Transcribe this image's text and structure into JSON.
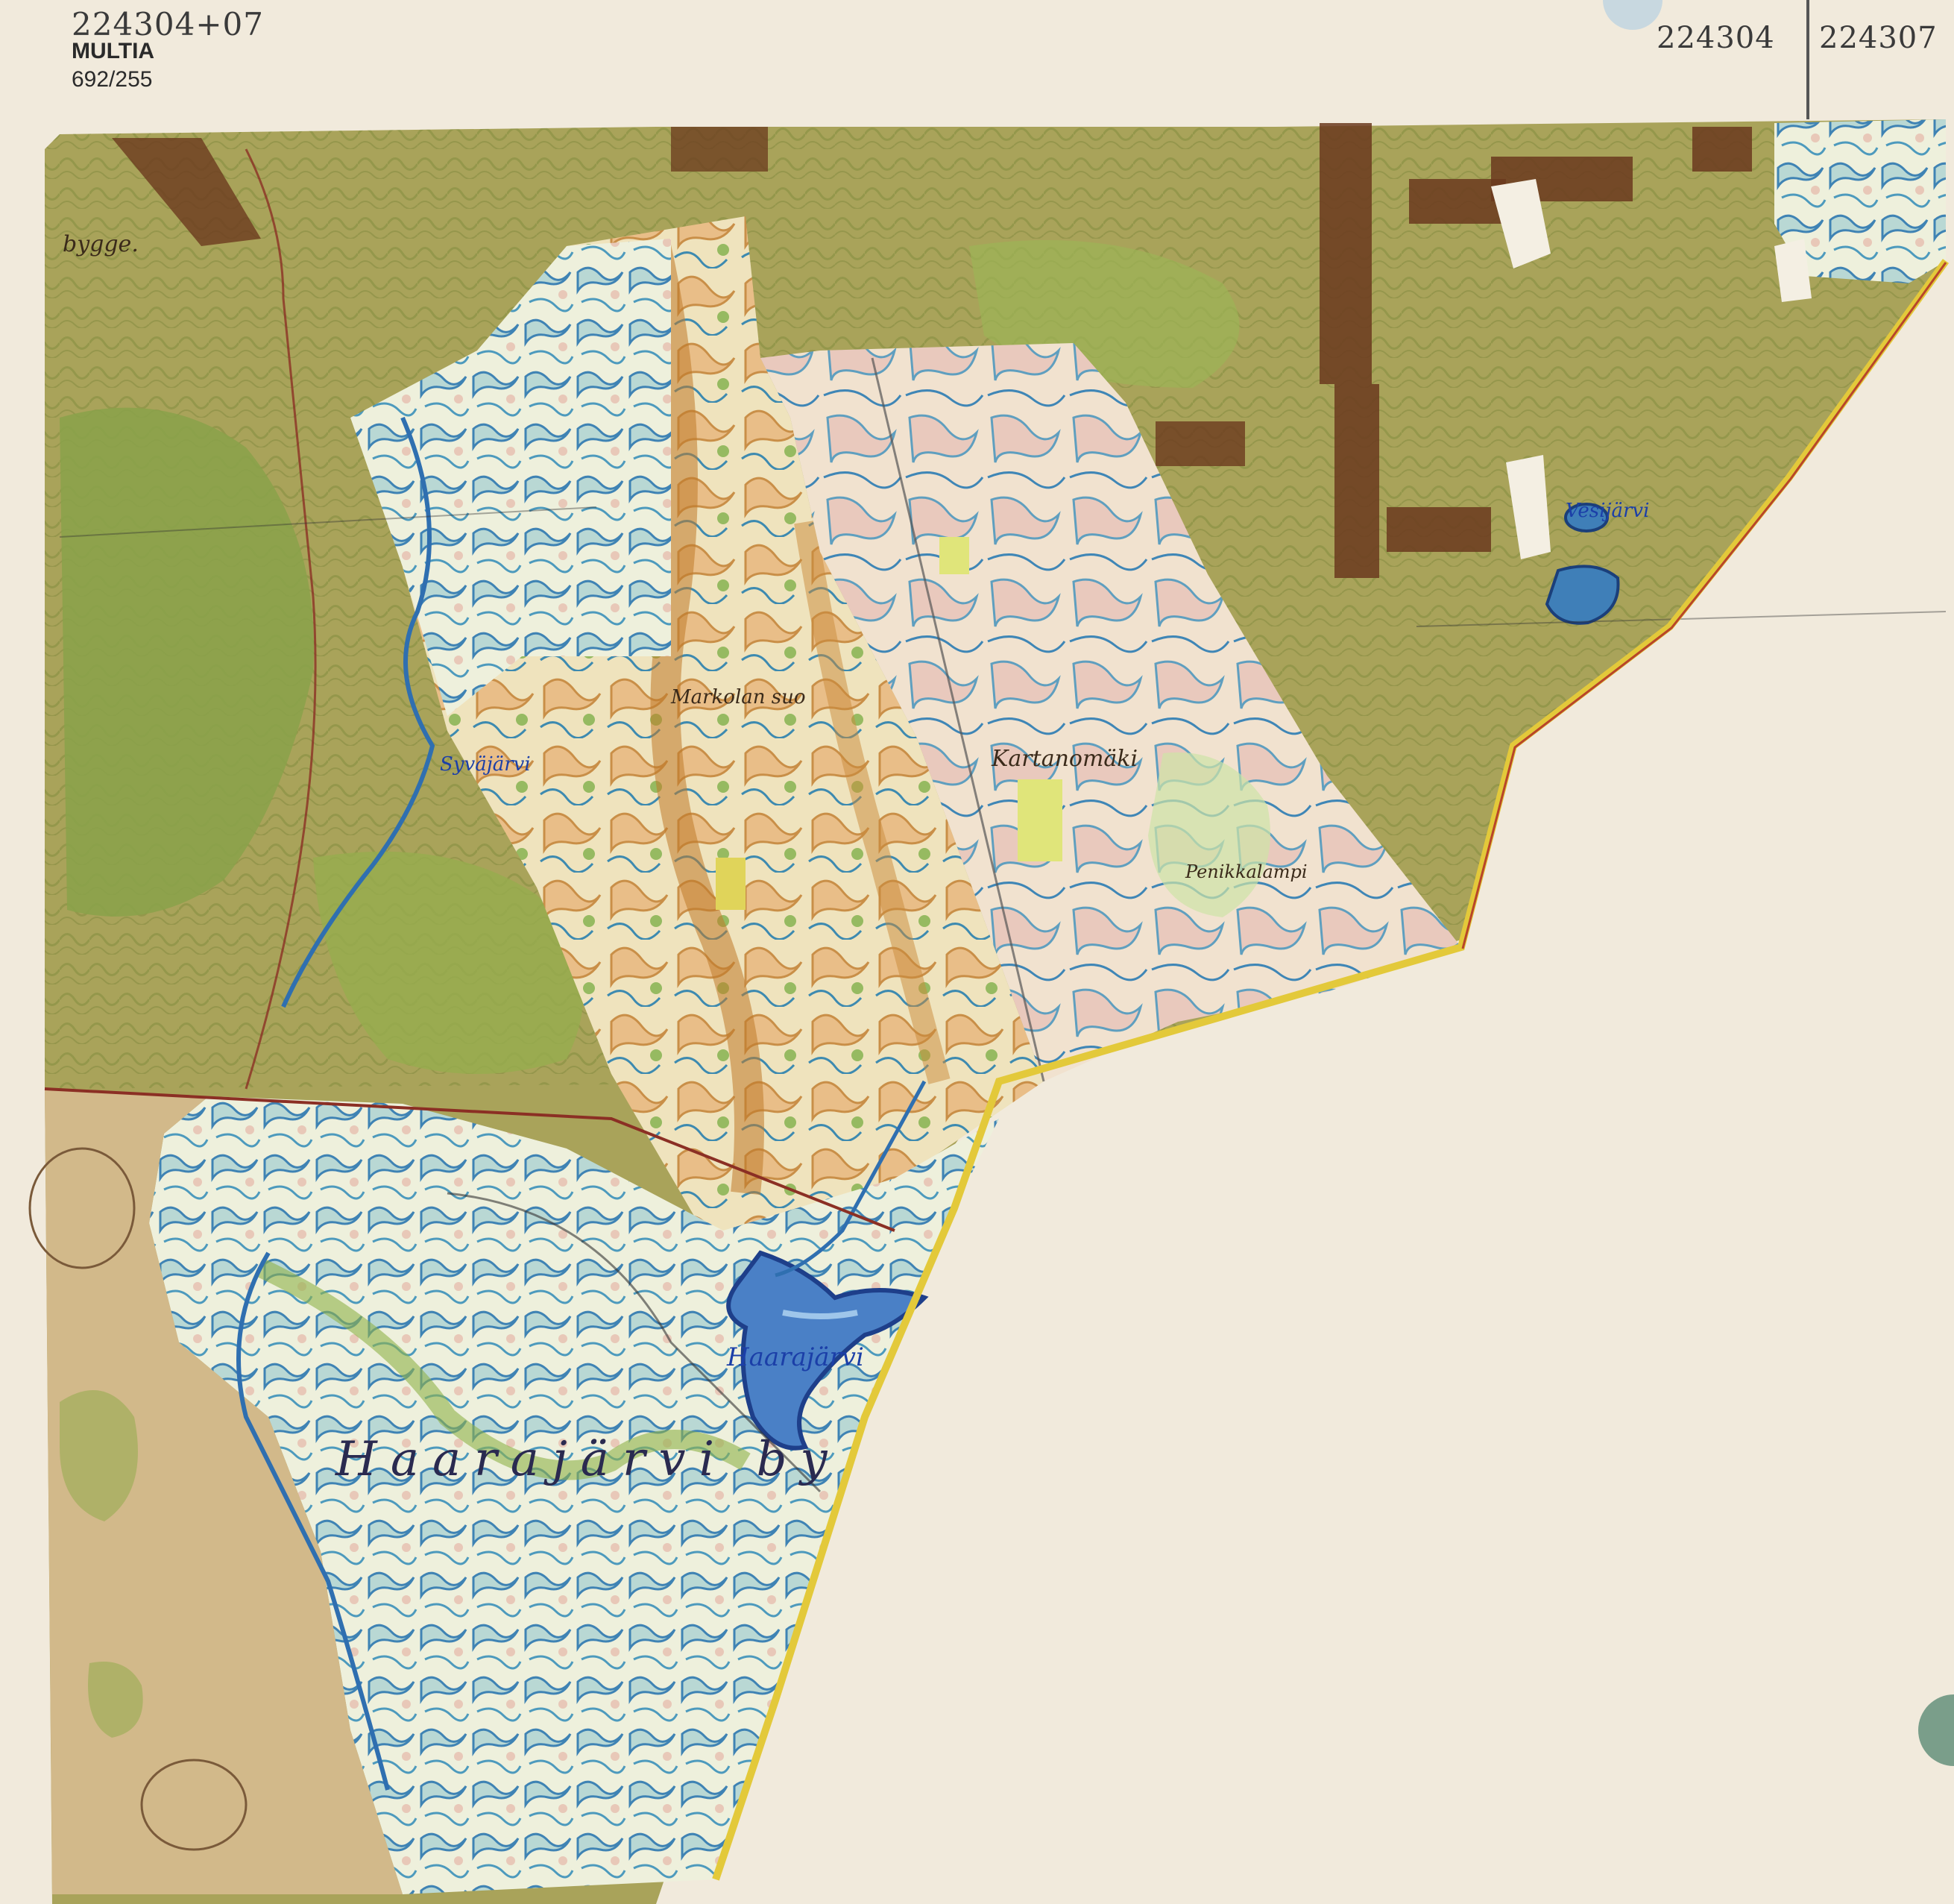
{
  "header": {
    "sheet_combined": "224304+07",
    "parish": "MULTIA",
    "sheet_number": "692/255",
    "sheet_left": "224304",
    "sheet_right": "224307"
  },
  "map": {
    "place_labels": {
      "bygge": "bygge.",
      "haarajarvi_lake": "Haarajärvi",
      "haarajarvi_by": "Haarajärvi by",
      "syvajarvi": "Syväjärvi",
      "vesijarvi": "Vesijärvi",
      "markola": "Markolan suo",
      "kartanomaki": "Kartanomäki",
      "penikka": "Penikkalampi"
    },
    "colors": {
      "base_olive": "#a9a35a",
      "forest_green": "#8aa24a",
      "marsh_orange": "#c98a3a",
      "pale_field": "#f2ead0",
      "water_blue": "#3f7fb8",
      "tape_brown": "#6b3a1e",
      "border_yellow": "#e3c93a"
    }
  }
}
